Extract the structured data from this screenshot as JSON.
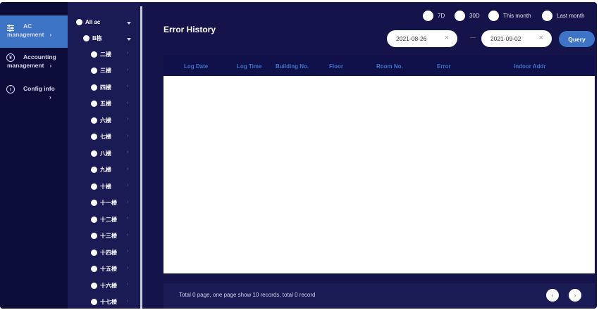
{
  "nav": {
    "items": [
      {
        "line1": "AC",
        "line2": "management",
        "active": true
      },
      {
        "line1": "Accounting",
        "line2": "management",
        "active": false
      },
      {
        "line1": "Config info",
        "active": false
      }
    ]
  },
  "tree": {
    "root": "All ac",
    "building": "B栋",
    "floors": [
      "二楼",
      "三楼",
      "四楼",
      "五楼",
      "六楼",
      "七楼",
      "八楼",
      "九楼",
      "十楼",
      "十一楼",
      "十二楼",
      "十三楼",
      "十四楼",
      "十五楼",
      "十六楼",
      "十七楼"
    ]
  },
  "page": {
    "title": "Error History"
  },
  "filters": {
    "ranges": [
      "7D",
      "30D",
      "This month",
      "Last month"
    ],
    "start_date": "2021-08-26",
    "end_date": "2021-09-02",
    "query_label": "Query"
  },
  "table": {
    "columns": [
      "Log Date",
      "Log Time",
      "Building No.",
      "Floor",
      "Room No.",
      "Error",
      "Indoor Addr"
    ]
  },
  "footer": {
    "summary": "Total 0 page,  one page show 10 records,  total 0 record"
  },
  "colors": {
    "accent": "#3d74c6",
    "background": "#14144a"
  }
}
